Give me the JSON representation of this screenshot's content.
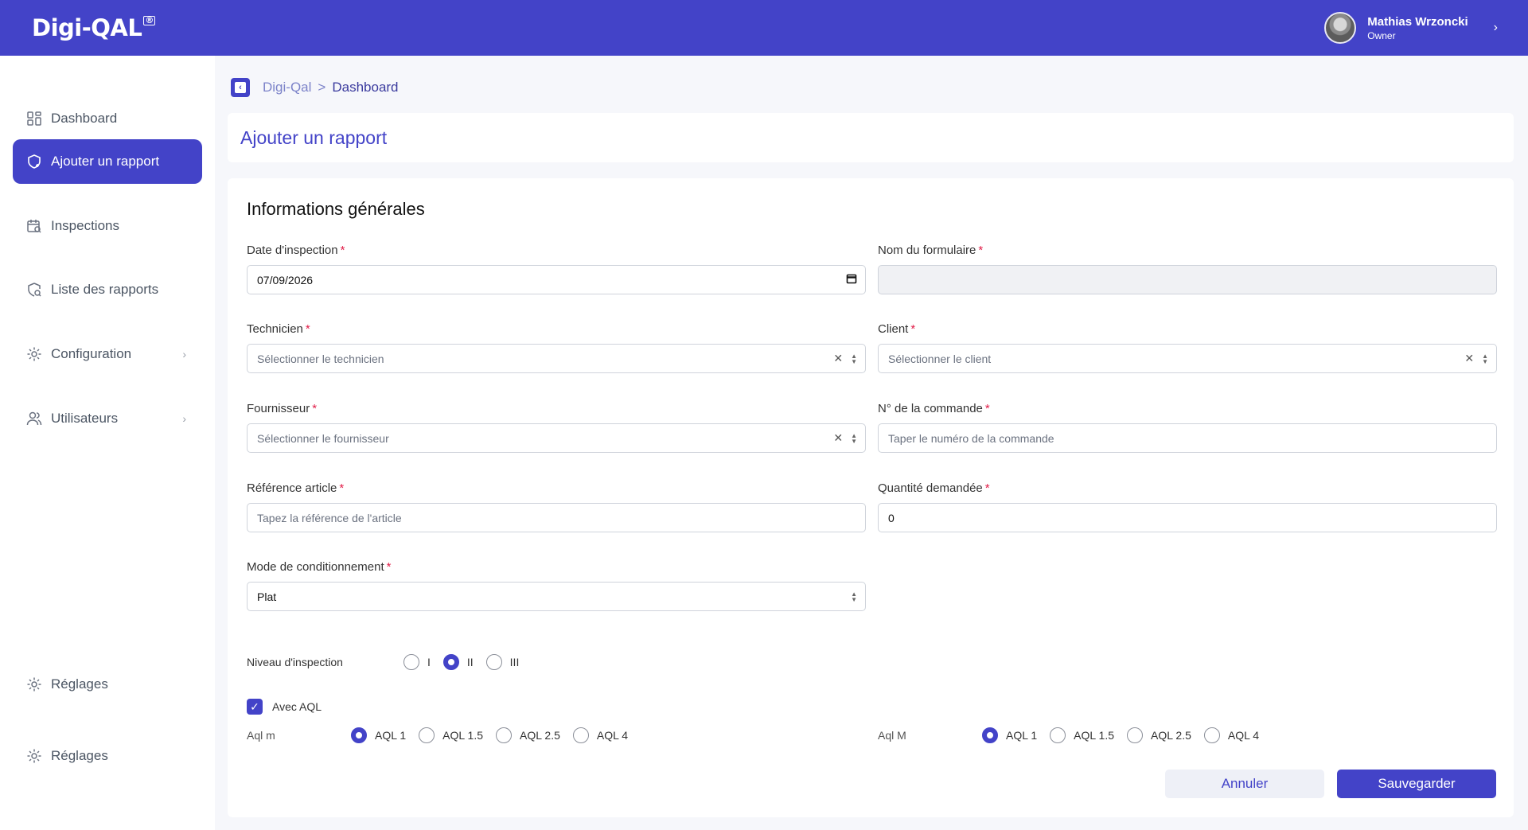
{
  "header": {
    "logo": "Digi-QAL",
    "logo_mark": "®",
    "user_name": "Mathias Wrzoncki",
    "user_role": "Owner"
  },
  "sidebar": {
    "items": [
      {
        "label": "Dashboard",
        "icon": "grid-icon"
      },
      {
        "label": "Ajouter un rapport",
        "icon": "shield-plus-icon",
        "active": true
      },
      {
        "label": "Inspections",
        "icon": "calendar-search-icon"
      },
      {
        "label": "Liste des rapports",
        "icon": "shield-search-icon"
      },
      {
        "label": "Configuration",
        "icon": "gear-icon"
      },
      {
        "label": "Utilisateurs",
        "icon": "users-icon"
      }
    ],
    "bottom_items": [
      {
        "label": "Réglages",
        "icon": "gear-icon"
      },
      {
        "label": "Réglages",
        "icon": "gear-icon"
      }
    ]
  },
  "breadcrumb": {
    "root": "Digi-Qal",
    "separator": ">",
    "current": "Dashboard"
  },
  "page_title": "Ajouter un rapport",
  "form": {
    "section_title": "Informations générales",
    "required_mark": "*",
    "date": {
      "label": "Date d'inspection",
      "value": "07/09/2026"
    },
    "form_name": {
      "label": "Nom du formulaire",
      "value": ""
    },
    "technician": {
      "label": "Technicien",
      "placeholder": "Sélectionner le technicien"
    },
    "client": {
      "label": "Client",
      "placeholder": "Sélectionner le client"
    },
    "supplier": {
      "label": "Fournisseur",
      "placeholder": "Sélectionner le fournisseur"
    },
    "order_number": {
      "label": "N° de la commande",
      "placeholder": "Taper le numéro de la commande"
    },
    "article_ref": {
      "label": "Référence article",
      "placeholder": "Tapez la référence de l'article"
    },
    "quantity": {
      "label": "Quantité demandée",
      "value": "0"
    },
    "packaging": {
      "label": "Mode de conditionnement",
      "value": "Plat"
    },
    "inspection_level": {
      "label": "Niveau d'inspection",
      "options": [
        "I",
        "II",
        "III"
      ],
      "selected": "II"
    },
    "with_aql": {
      "label": "Avec AQL",
      "checked": true
    },
    "aql_minor": {
      "label": "Aql m",
      "options": [
        "AQL 1",
        "AQL 1.5",
        "AQL 2.5",
        "AQL 4"
      ],
      "selected": "AQL 1"
    },
    "aql_major": {
      "label": "Aql M",
      "options": [
        "AQL 1",
        "AQL 1.5",
        "AQL 2.5",
        "AQL 4"
      ],
      "selected": "AQL 1"
    },
    "cancel_label": "Annuler",
    "save_label": "Sauvegarder"
  },
  "colors": {
    "primary": "#4343c8",
    "required": "#e11d48"
  }
}
